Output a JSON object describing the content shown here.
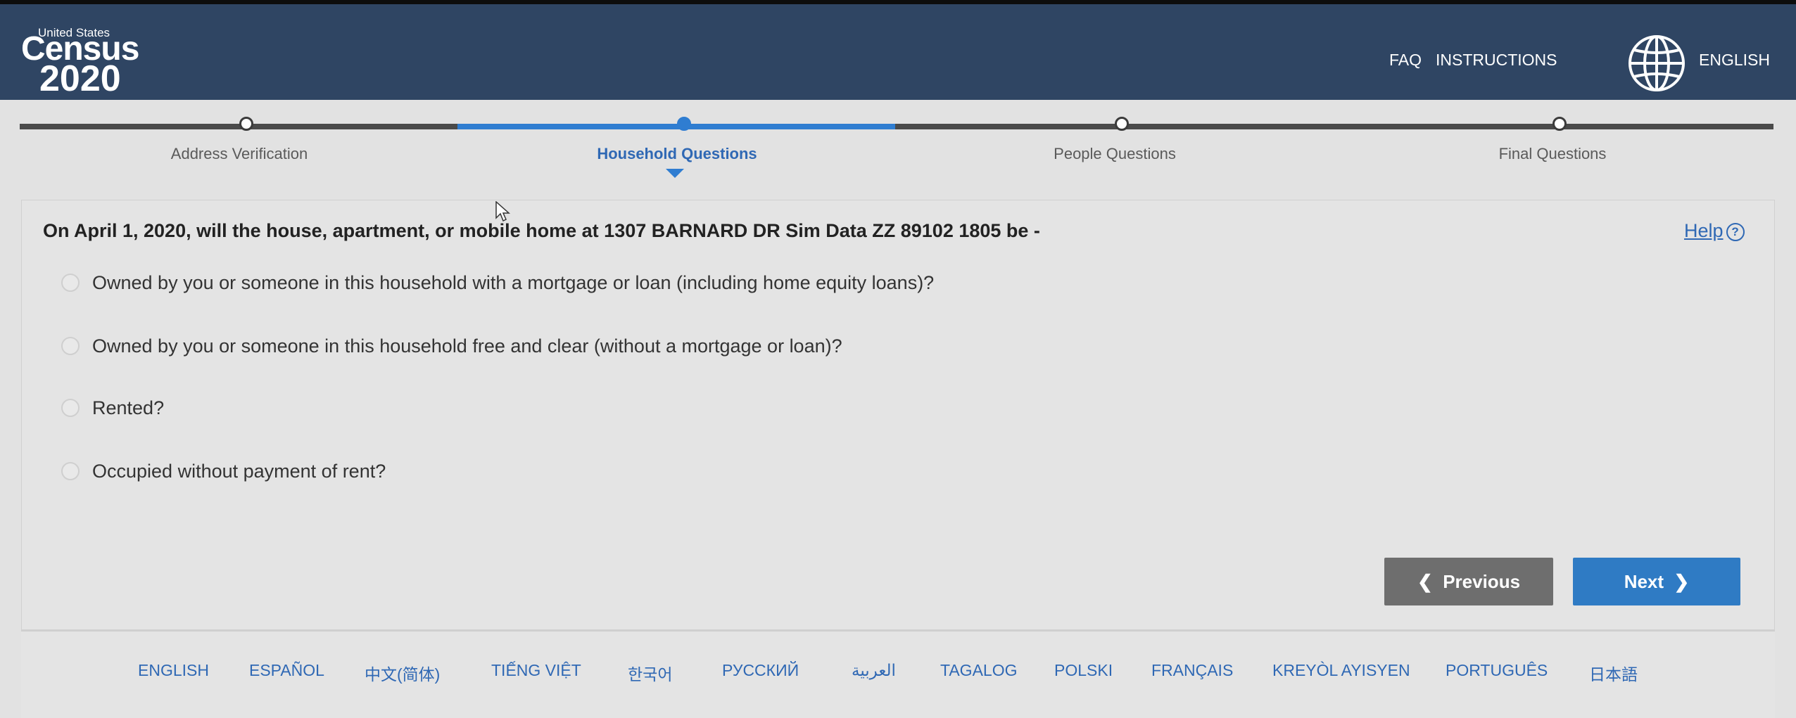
{
  "header": {
    "logo_top": "United States",
    "logo_mid": "Census",
    "logo_year": "2020",
    "faq": "FAQ",
    "instructions": "INSTRUCTIONS",
    "language": "ENGLISH",
    "icon": "globe-icon",
    "background_color": "#2f4563"
  },
  "progress": {
    "steps": [
      {
        "label": "Address Verification",
        "state": "complete"
      },
      {
        "label": "Household Questions",
        "state": "current"
      },
      {
        "label": "People Questions",
        "state": "upcoming"
      },
      {
        "label": "Final Questions",
        "state": "upcoming"
      }
    ],
    "active_color": "#2f7dd1"
  },
  "question": {
    "text": "On April 1, 2020, will the house, apartment, or mobile home at 1307 BARNARD DR Sim Data ZZ 89102 1805 be -",
    "help": "Help",
    "options": [
      "Owned by you or someone in this household with a mortgage or loan (including home equity loans)?",
      "Owned by you or someone in this household free and clear (without a mortgage or loan)?",
      "Rented?",
      "Occupied without payment of rent?"
    ]
  },
  "buttons": {
    "previous": "Previous",
    "next": "Next",
    "previous_color": "#6e6e6e",
    "next_color": "#2f7bc4"
  },
  "footer": {
    "languages": [
      "ENGLISH",
      "ESPAÑOL",
      "中文(简体)",
      "TIẾNG VIỆT",
      "한국어",
      "РУССКИЙ",
      "العربية",
      "TAGALOG",
      "POLSKI",
      "FRANÇAIS",
      "KREYÒL AYISYEN",
      "PORTUGUÊS",
      "日本語"
    ]
  }
}
